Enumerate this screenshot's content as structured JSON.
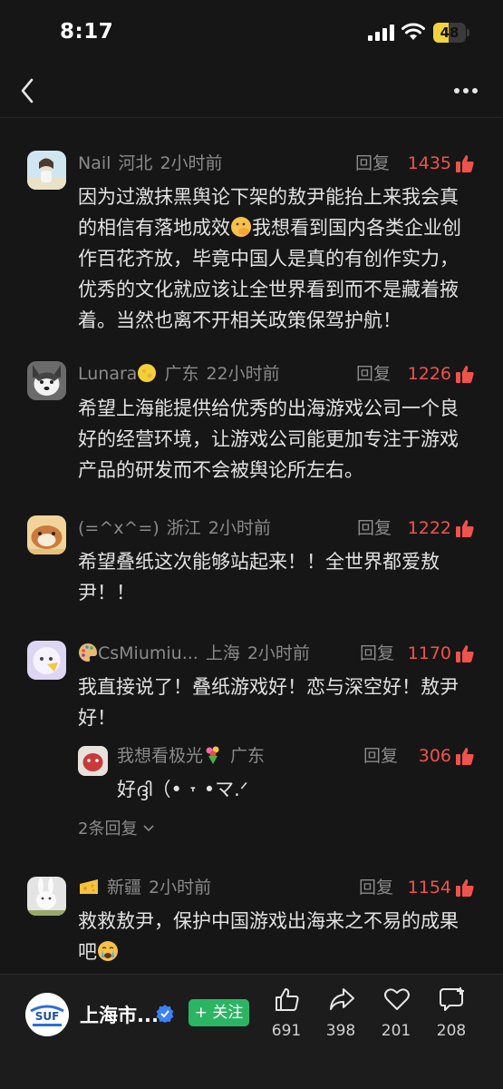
{
  "status_bar": {
    "time": "8:17",
    "battery": "48",
    "battery_level": 0.48
  },
  "nav": {
    "back_icon": "chevron-left-icon",
    "more_icon": "more-icon"
  },
  "comments": [
    {
      "user": "Nail",
      "region": "河北",
      "time": "2小时前",
      "reply_label": "回复",
      "likes": "1435",
      "text_before": "因为过激抹黑舆论下架的敖尹能抬上来我会真的相信有落地成效",
      "emoji": "face-with-hand-over-mouth-icon",
      "text_after": "我想看到国内各类企业创作百花齐放，毕竟中国人是真的有创作实力，优秀的文化就应该让全世界看到而不是藏着掖着。当然也离不开相关政策保驾护航！"
    },
    {
      "user": "Lunara",
      "user_emoji": "moon-icon",
      "region": "广东",
      "time": "22小时前",
      "reply_label": "回复",
      "likes": "1226",
      "text": "希望上海能提供给优秀的出海游戏公司一个良好的经营环境，让游戏公司能更加专注于游戏产品的研发而不会被舆论所左右。"
    },
    {
      "user": "(=^x^=)",
      "region": "浙江",
      "time": "2小时前",
      "reply_label": "回复",
      "likes": "1222",
      "text": "希望叠纸这次能够站起来！！全世界都爱敖尹！！"
    },
    {
      "user": "CsMiumiu...",
      "user_emoji": "palette-icon",
      "region": "上海",
      "time": "2小时前",
      "reply_label": "回复",
      "likes": "1170",
      "text": "我直接说了！叠纸游戏好！恋与深空好！敖尹好！",
      "reply": {
        "user": "我想看极光",
        "user_emoji": "bouquet-icon",
        "region": "广东",
        "reply_label": "回复",
        "likes": "306",
        "text": "好ദ്ദി（• ˕ •マ.ᐟ"
      },
      "more_replies": "2条回复"
    },
    {
      "user_emoji": "cheese-icon",
      "region": "新疆",
      "time": "2小时前",
      "reply_label": "回复",
      "likes": "1154",
      "text_before": "救救敖尹，保护中国游戏出海来之不易的成果吧",
      "emoji": "crying-face-icon"
    }
  ],
  "bottom_bar": {
    "account_name": "上海市...",
    "logo_text": "SUF",
    "follow_label": "+ 关注",
    "actions": [
      {
        "icon": "thumbs-up-icon",
        "count": "691"
      },
      {
        "icon": "share-icon",
        "count": "398"
      },
      {
        "icon": "heart-icon",
        "count": "201"
      },
      {
        "icon": "comment-add-icon",
        "count": "208"
      }
    ]
  },
  "colors": {
    "background": "#161616",
    "like_red": "#f0524c",
    "follow_green": "#2bb563",
    "battery_yellow": "#f3d33b"
  }
}
